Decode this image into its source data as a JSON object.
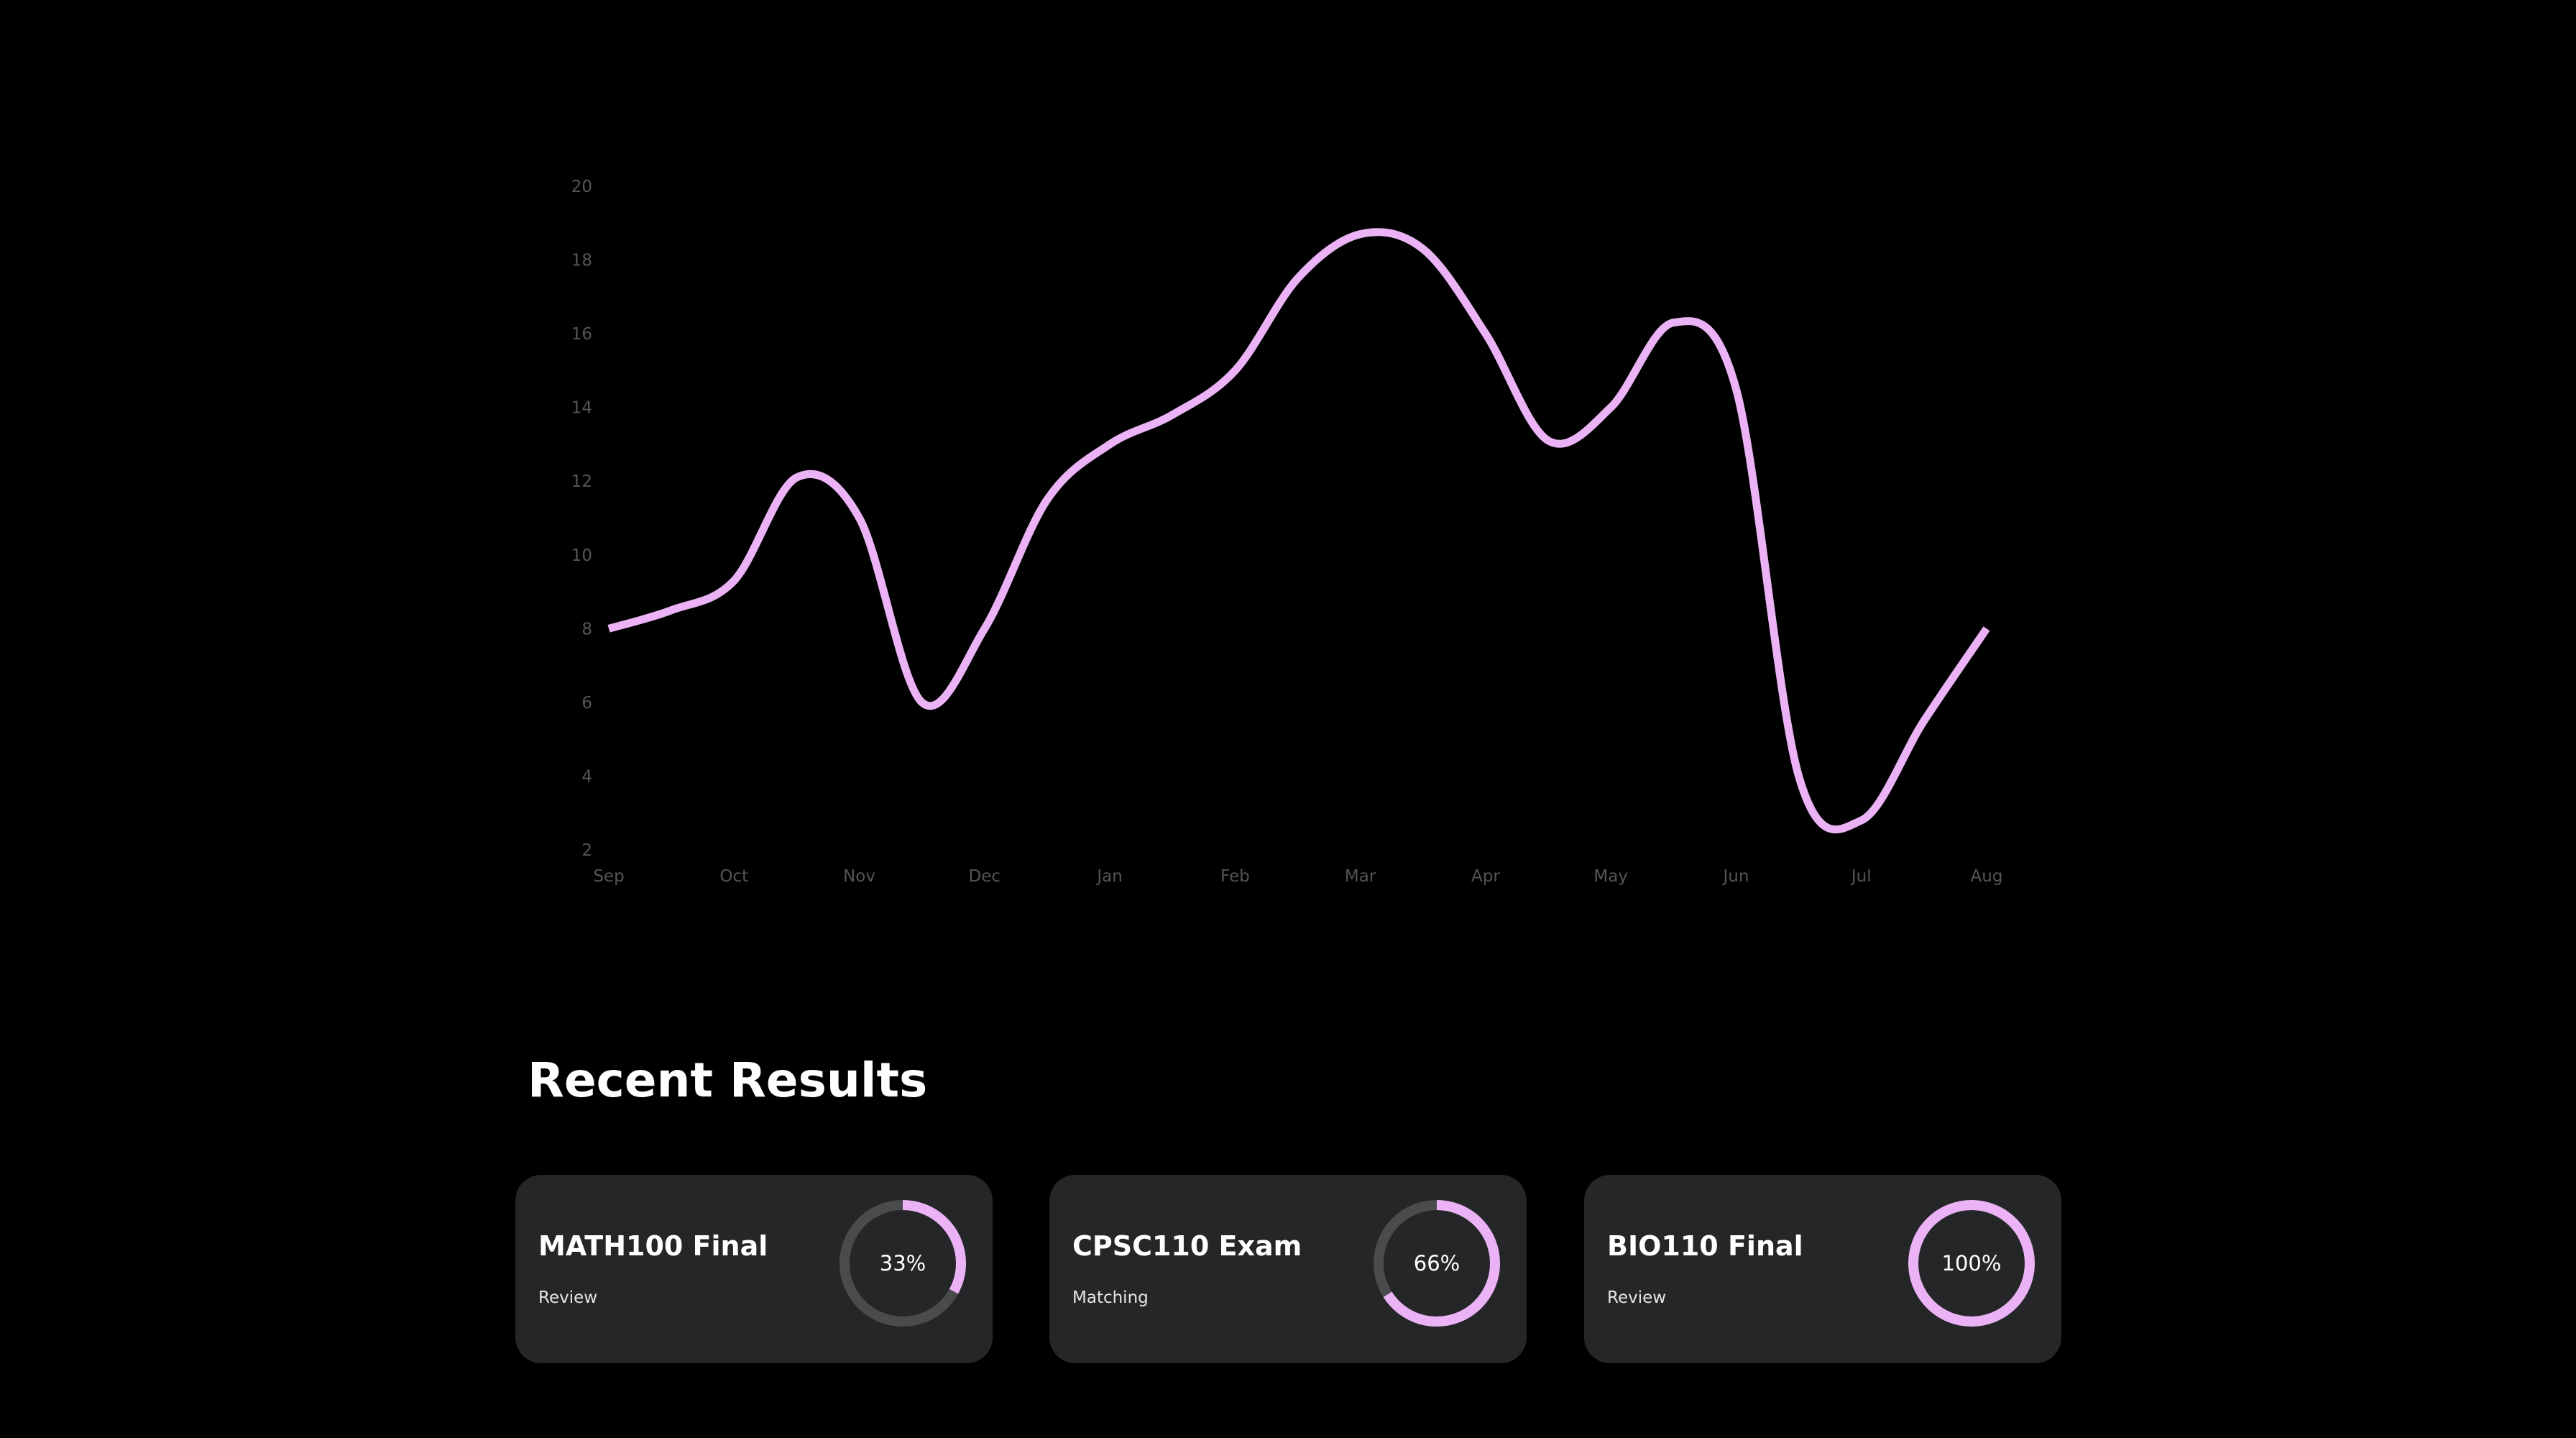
{
  "colors": {
    "background": "#000000",
    "accent": "#ebb3f5",
    "card_bg": "#252628",
    "ring_track": "#4a4b4d",
    "axis_text": "#555555"
  },
  "chart_data": {
    "type": "line",
    "title": "",
    "xlabel": "",
    "ylabel": "",
    "categories": [
      "Sep",
      "Oct",
      "Nov",
      "Dec",
      "Jan",
      "Feb",
      "Mar",
      "Apr",
      "May",
      "Jun",
      "Jul",
      "Aug"
    ],
    "x": [
      0,
      0.5,
      1,
      1.5,
      2,
      2.5,
      3,
      3.5,
      4,
      4.5,
      5,
      5.5,
      6,
      6.5,
      7,
      7.5,
      8,
      8.5,
      9,
      9.5,
      10,
      10.5,
      11
    ],
    "series": [
      {
        "values": [
          8,
          8.5,
          9.3,
          12.1,
          11.0,
          6.0,
          8.0,
          11.5,
          13,
          13.8,
          15.0,
          17.5,
          18.7,
          18.3,
          16.0,
          13.1,
          14.0,
          16.3,
          14.5,
          4.0,
          2.8,
          5.5,
          8.0
        ]
      }
    ],
    "ylim": [
      2,
      20
    ],
    "yticks": [
      2,
      4,
      6,
      8,
      10,
      12,
      14,
      16,
      18,
      20
    ],
    "grid": false,
    "legend": "none"
  },
  "recent_results": {
    "title": "Recent Results",
    "cards": [
      {
        "title": "MATH100 Final",
        "subtitle": "Review",
        "percent_label": "33%",
        "progress": 0.33
      },
      {
        "title": "CPSC110 Exam",
        "subtitle": "Matching",
        "percent_label": "66%",
        "progress": 0.66
      },
      {
        "title": "BIO110 Final",
        "subtitle": "Review",
        "percent_label": "100%",
        "progress": 1.0
      }
    ]
  }
}
